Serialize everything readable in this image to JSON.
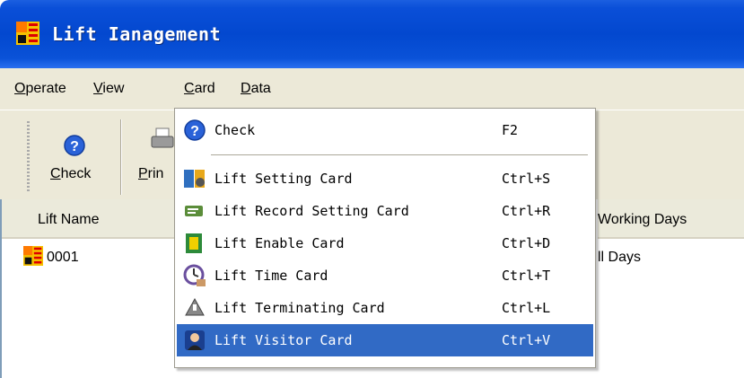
{
  "window": {
    "title": "Lift Ianagement"
  },
  "menubar": [
    {
      "label": "Operate",
      "key": "O",
      "rest": "perate"
    },
    {
      "label": "View",
      "key": "V",
      "rest": "iew"
    },
    {
      "label": "Card",
      "key": "C",
      "rest": "ard"
    },
    {
      "label": "Data",
      "key": "D",
      "rest": "ata"
    }
  ],
  "toolbar": {
    "check_key": "C",
    "check_rest": "heck",
    "print_key": "P",
    "print_rest": "rin"
  },
  "list": {
    "headers": {
      "name": "Lift Name",
      "working_days": "Working Days"
    },
    "rows": [
      {
        "name": "0001",
        "working_days": "ll Days"
      }
    ]
  },
  "card_menu": {
    "items": [
      {
        "label": "Check",
        "shortcut": "F2",
        "icon": "help-icon"
      },
      {
        "label": "Lift Setting Card",
        "shortcut": "Ctrl+S",
        "icon": "setting-card-icon"
      },
      {
        "label": "Lift Record Setting Card",
        "shortcut": "Ctrl+R",
        "icon": "record-card-icon"
      },
      {
        "label": "Lift Enable Card",
        "shortcut": "Ctrl+D",
        "icon": "enable-card-icon"
      },
      {
        "label": "Lift Time Card",
        "shortcut": "Ctrl+T",
        "icon": "time-card-icon"
      },
      {
        "label": "Lift Terminating Card",
        "shortcut": "Ctrl+L",
        "icon": "terminating-card-icon"
      },
      {
        "label": "Lift Visitor Card",
        "shortcut": "Ctrl+V",
        "icon": "visitor-card-icon",
        "selected": true
      }
    ]
  },
  "colors": {
    "titlebar": "#0348cf",
    "selection": "#316ac5",
    "face": "#ece9d8"
  }
}
